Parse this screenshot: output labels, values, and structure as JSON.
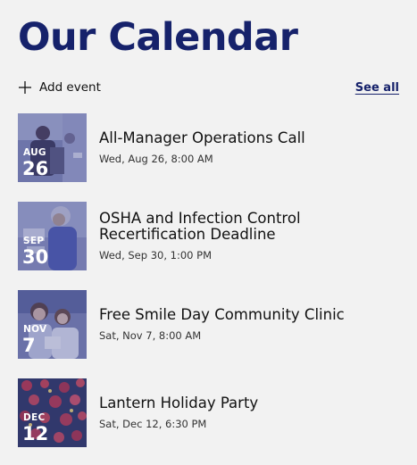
{
  "page_title": "Our Calendar",
  "actions": {
    "add_event_label": "Add event",
    "see_all_label": "See all"
  },
  "icons": {
    "add": "plus-icon"
  },
  "colors": {
    "title": "#16226b",
    "link": "#16226b",
    "background": "#f2f2f2",
    "thumbnail_tint": "#5560a8"
  },
  "events": [
    {
      "month": "AUG",
      "day": "26",
      "title": "All-Manager Operations Call",
      "time": "Wed, Aug 26, 8:00 AM"
    },
    {
      "month": "SEP",
      "day": "30",
      "title": "OSHA and Infection Control Recertification Deadline",
      "time": "Wed, Sep 30, 1:00 PM"
    },
    {
      "month": "NOV",
      "day": "7",
      "title": "Free Smile Day Community Clinic",
      "time": "Sat, Nov 7, 8:00 AM"
    },
    {
      "month": "DEC",
      "day": "12",
      "title": "Lantern Holiday Party",
      "time": "Sat, Dec 12, 6:30 PM"
    }
  ]
}
